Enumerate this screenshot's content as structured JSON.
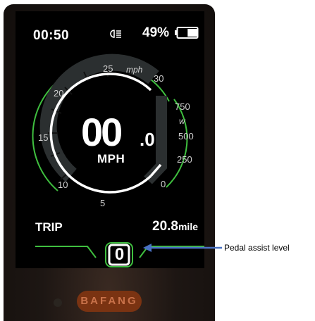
{
  "status": {
    "time": "00:50",
    "battery_percent": "49%",
    "battery_level": 0.49,
    "light_icon": "headlight-icon"
  },
  "speedometer": {
    "speed_value": "00",
    "speed_decimal": ".0",
    "speed_unit": "MPH",
    "speed_scale_unit": "mph",
    "speed_ticks": [
      "5",
      "10",
      "15",
      "20",
      "25",
      "30"
    ],
    "power_scale_unit": "w",
    "power_ticks": [
      "0",
      "250",
      "500",
      "750"
    ]
  },
  "trip": {
    "label": "TRIP",
    "distance": "20.8",
    "distance_unit": "mile"
  },
  "assist": {
    "level": "0"
  },
  "brand": {
    "name": "BAFANG"
  },
  "annotation": {
    "label": "Pedal assist level"
  },
  "colors": {
    "accent_green": "#3fbf3f",
    "arrow_blue": "#4a72c4",
    "brand_orange": "#7a3312"
  }
}
